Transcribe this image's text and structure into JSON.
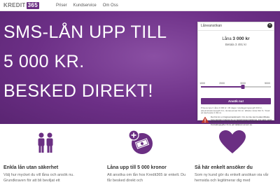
{
  "nav": {
    "logo_text": "KREDIT",
    "logo_number": "365",
    "items": [
      "Priser",
      "Kundservice",
      "Om Oss"
    ]
  },
  "hero": {
    "lines": [
      "SMS-LÅN UPP TILL",
      "5 000 KR.",
      "BESKED DIREKT!"
    ]
  },
  "widget": {
    "title": "Låneansökan",
    "amount_label": "Låna",
    "amount_value": "3 000 kr",
    "repay_label": "Betala",
    "repay_value": "3 491 kr",
    "slider_ticks": [
      "1000",
      "2000",
      "3000",
      "5000"
    ],
    "slider_level": 0.6,
    "apply_label": "Ansök nu!",
    "fine_print": "Prisexempel: Låna 3 000 kr i 30 dagar. Uppläggningsavgift 300 kr, administrationsavgift 0 kr, räntekostnad 191 kr. Effektiv ränta 932 %. Totalt att återbetala 3 491 kr.",
    "warning_text": "Det här är en högkostnadskredit. Om du inte kan betala tillbaka hela skulden riskerar du en betalningsanmärkning. För stöd, vänd dig till budget- och skuldrådgivningen i din kommun. Kontaktuppgifter finns på hallakonsument.se."
  },
  "features": [
    {
      "title": "Enkla lån utan säkerhet",
      "text": "Välj hur mycket du vill låna och ansök nu. Grundkraven för att bli beviljat ett"
    },
    {
      "title": "Låna upp till 5 000 kronor",
      "text": "Att ansöka om lån hos Kredit365 är enkelt. Du får besked direkt och"
    },
    {
      "title": "Så här enkelt ansöker du",
      "text": "Som ny kund gör du enkelt ansökan via vår hemsida och legitimerar dig med"
    }
  ],
  "colors": {
    "brand_purple": "#6b2f83",
    "warning_red": "#c0392b"
  }
}
